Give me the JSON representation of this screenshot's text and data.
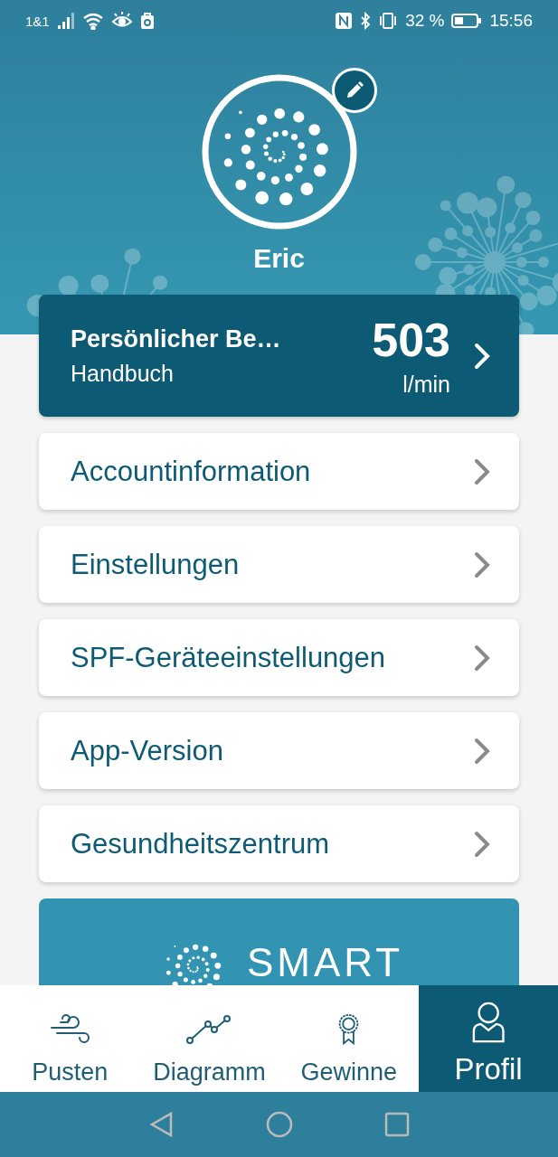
{
  "status_bar": {
    "carrier": "1&1",
    "battery": "32 %",
    "time": "15:56"
  },
  "profile": {
    "name": "Eric"
  },
  "best_value_card": {
    "title": "Persönlicher Be…",
    "subtitle": "Handbuch",
    "value": "503",
    "unit": "l/min"
  },
  "menu": [
    {
      "label": "Accountinformation"
    },
    {
      "label": "Einstellungen"
    },
    {
      "label": "SPF-Geräteeinstellungen"
    },
    {
      "label": "App-Version"
    },
    {
      "label": "Gesundheitszentrum"
    }
  ],
  "logo": {
    "text": "SMART"
  },
  "tabs": [
    {
      "label": "Pusten",
      "selected": false
    },
    {
      "label": "Diagramm",
      "selected": false
    },
    {
      "label": "Gewinne",
      "selected": false
    },
    {
      "label": "Profil",
      "selected": true
    }
  ]
}
